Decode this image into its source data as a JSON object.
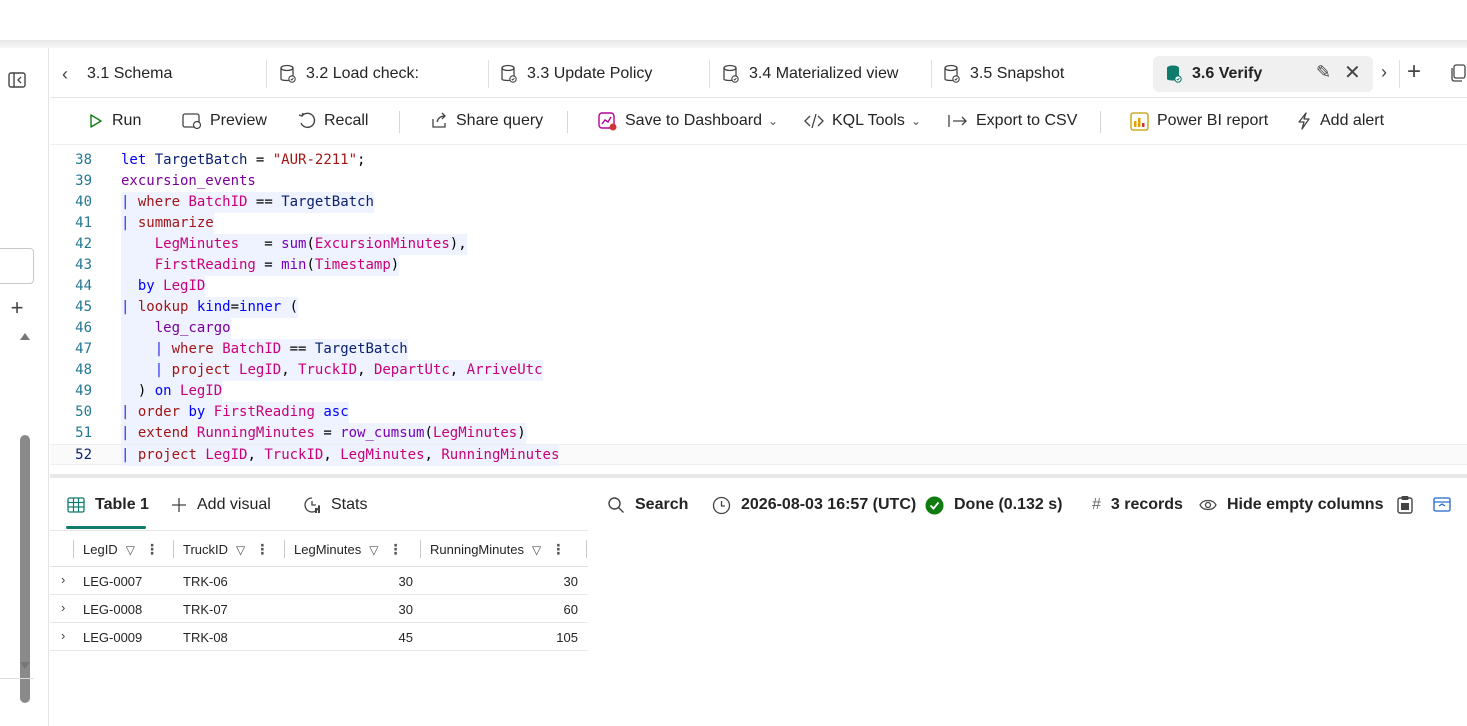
{
  "tabs": [
    {
      "label": "3.1 Schema",
      "icon": "none"
    },
    {
      "label": "3.2 Load check:",
      "icon": "database-icon"
    },
    {
      "label": "3.3 Update Policy",
      "icon": "database-icon"
    },
    {
      "label": "3.4 Materialized view",
      "icon": "database-icon"
    },
    {
      "label": "3.5 Snapshot",
      "icon": "database-icon"
    },
    {
      "label": "3.6 Verify",
      "icon": "database-icon",
      "active": true
    }
  ],
  "toolbar": {
    "run": "Run",
    "preview": "Preview",
    "recall": "Recall",
    "share": "Share query",
    "save_dashboard": "Save to Dashboard",
    "kql_tools": "KQL Tools",
    "export_csv": "Export to CSV",
    "powerbi": "Power BI report",
    "add_alert": "Add alert"
  },
  "editor": {
    "line_numbers": [
      "38",
      "39",
      "40",
      "41",
      "42",
      "43",
      "44",
      "45",
      "46",
      "47",
      "48",
      "49",
      "50",
      "51",
      "52"
    ],
    "current_line": "52"
  },
  "results": {
    "table_tab": "Table 1",
    "add_visual": "Add visual",
    "stats": "Stats",
    "search": "Search",
    "timestamp": "2026-08-03 16:57 (UTC)",
    "status": "Done (0.132 s)",
    "records_prefix": "#",
    "records": "3 records",
    "hide_empty": "Hide empty columns"
  },
  "grid": {
    "columns": [
      "LegID",
      "TruckID",
      "LegMinutes",
      "RunningMinutes"
    ],
    "rows": [
      {
        "LegID": "LEG-0007",
        "TruckID": "TRK-06",
        "LegMinutes": "30",
        "RunningMinutes": "30"
      },
      {
        "LegID": "LEG-0008",
        "TruckID": "TRK-07",
        "LegMinutes": "30",
        "RunningMinutes": "60"
      },
      {
        "LegID": "LEG-0009",
        "TruckID": "TRK-08",
        "LegMinutes": "45",
        "RunningMinutes": "105"
      }
    ]
  },
  "colors": {
    "accent": "#0f7b6c",
    "success": "#107c10",
    "line_number": "#237893"
  }
}
